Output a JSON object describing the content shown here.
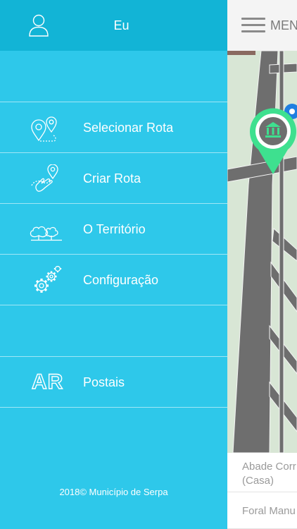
{
  "drawer": {
    "user": {
      "name": "Eu",
      "icon": "user-icon"
    },
    "items": [
      {
        "label": "Selecionar Rota",
        "icon": "route-pins-icon"
      },
      {
        "label": "Criar Rota",
        "icon": "create-route-icon"
      },
      {
        "label": "O Território",
        "icon": "territory-trees-icon"
      },
      {
        "label": "Configuração",
        "icon": "gears-icon"
      },
      {
        "label": "Postais",
        "icon": "ar-icon",
        "icon_text": "AR"
      }
    ],
    "footer": "2018© Município de Serpa"
  },
  "main": {
    "menu_label": "MENU",
    "pin_icon": "museum-icon",
    "list": [
      {
        "line1": "Abade Corr",
        "line2": "(Casa)"
      },
      {
        "line1": "Foral Manu"
      }
    ]
  },
  "colors": {
    "drawer_bg": "#2ec8ea",
    "drawer_header_bg": "#12b4d6",
    "map_road": "#6e6e6e",
    "map_ground": "#d8e6d5",
    "pin": "#3ee08f"
  }
}
